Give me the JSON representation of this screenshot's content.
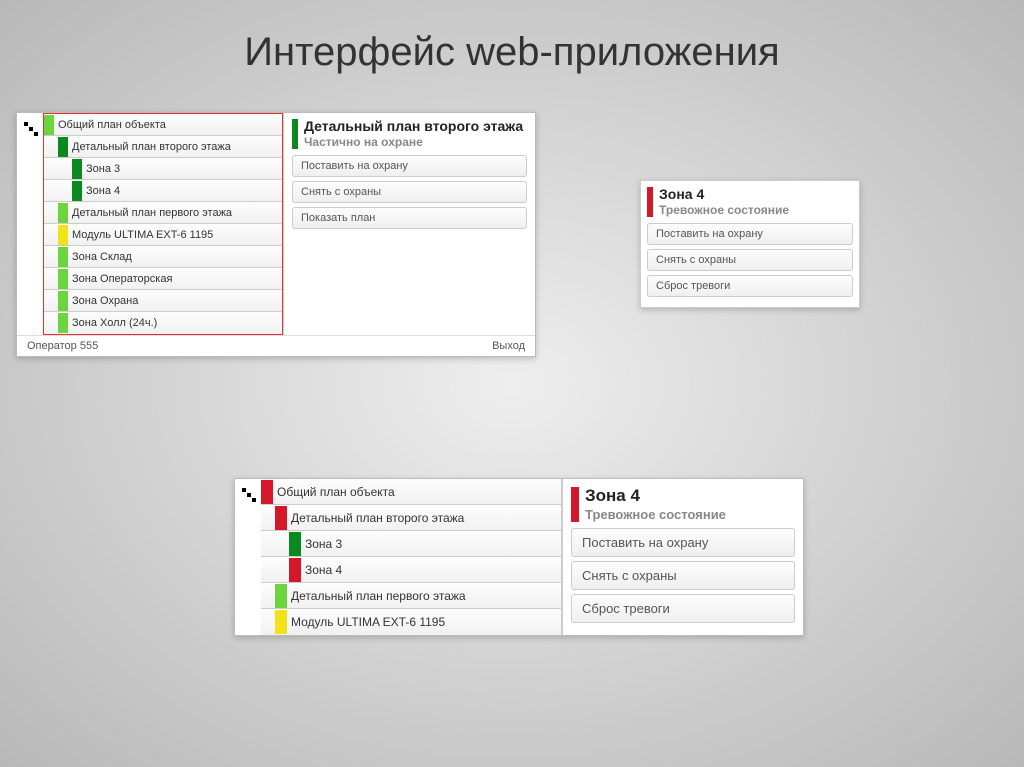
{
  "slide_title": "Интерфейс web-приложения",
  "panel_a": {
    "tree": [
      {
        "label": "Общий план объекта",
        "indent": 0,
        "color": "c-lightgreen"
      },
      {
        "label": "Детальный план второго этажа",
        "indent": 1,
        "color": "c-green"
      },
      {
        "label": "Зона 3",
        "indent": 2,
        "color": "c-green"
      },
      {
        "label": "Зона 4",
        "indent": 2,
        "color": "c-green"
      },
      {
        "label": "Детальный план первого этажа",
        "indent": 1,
        "color": "c-lightgreen"
      },
      {
        "label": "Модуль ULTIMA EXT-6 1195",
        "indent": 1,
        "color": "c-yellow"
      },
      {
        "label": "Зона Склад",
        "indent": 1,
        "color": "c-lightgreen"
      },
      {
        "label": "Зона Операторская",
        "indent": 1,
        "color": "c-lightgreen"
      },
      {
        "label": "Зона Охрана",
        "indent": 1,
        "color": "c-lightgreen"
      },
      {
        "label": "Зона Холл (24ч.)",
        "indent": 1,
        "color": "c-lightgreen"
      }
    ],
    "detail": {
      "title": "Детальный план второго этажа",
      "subtitle": "Частично на охране",
      "actions": [
        "Поставить на охрану",
        "Снять с охраны",
        "Показать план"
      ]
    },
    "footer": {
      "left": "Оператор 555",
      "right": "Выход"
    }
  },
  "panel_b": {
    "title": "Зона 4",
    "subtitle": "Тревожное состояние",
    "actions": [
      "Поставить на охрану",
      "Снять с охраны",
      "Сброс тревоги"
    ]
  },
  "panel_c": {
    "tree": [
      {
        "label": "Общий план объекта",
        "indent": 0,
        "color": "c-red"
      },
      {
        "label": "Детальный план второго этажа",
        "indent": 1,
        "color": "c-red"
      },
      {
        "label": "Зона 3",
        "indent": 2,
        "color": "c-green"
      },
      {
        "label": "Зона 4",
        "indent": 2,
        "color": "c-red"
      },
      {
        "label": "Детальный план первого этажа",
        "indent": 1,
        "color": "c-lightgreen"
      },
      {
        "label": "Модуль ULTIMA EXT-6 1195",
        "indent": 1,
        "color": "c-yellow"
      }
    ],
    "detail": {
      "title": "Зона 4",
      "subtitle": "Тревожное состояние",
      "actions": [
        "Поставить на охрану",
        "Снять с охраны",
        "Сброс тревоги"
      ]
    }
  }
}
